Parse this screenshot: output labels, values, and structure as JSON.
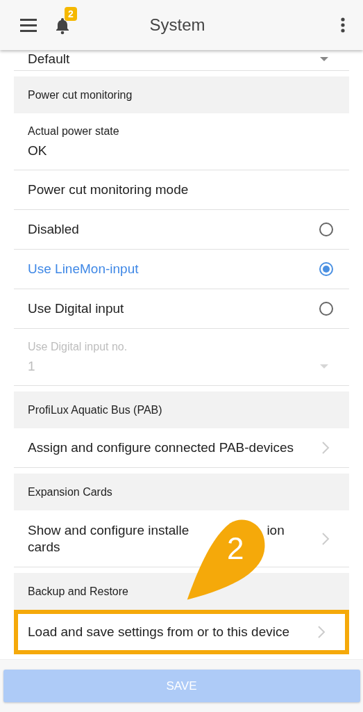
{
  "app_bar": {
    "title": "System",
    "notification_count": "2"
  },
  "items": [
    {
      "kind": "select",
      "value": "Default"
    },
    {
      "kind": "section",
      "label": "Power cut monitoring"
    },
    {
      "kind": "info",
      "label": "Actual power state",
      "value": "OK"
    },
    {
      "kind": "heading",
      "label": "Power cut monitoring mode"
    },
    {
      "kind": "radio",
      "label": "Disabled",
      "selected": false
    },
    {
      "kind": "radio",
      "label": "Use LineMon-input",
      "selected": true
    },
    {
      "kind": "radio",
      "label": "Use Digital input",
      "selected": false
    },
    {
      "kind": "select",
      "label": "Use Digital input no.",
      "value": "1",
      "disabled": true
    },
    {
      "kind": "section",
      "label": "ProfiLux Aquatic Bus (PAB)"
    },
    {
      "kind": "link",
      "label": "Assign and configure connected PAB-devices",
      "highlighted": false
    },
    {
      "kind": "section",
      "label": "Expansion Cards"
    },
    {
      "kind": "link",
      "label_parts": [
        "Show and configure installe",
        "ion"
      ],
      "label_line_2": "cards"
    },
    {
      "kind": "section",
      "label": "Backup and Restore"
    },
    {
      "kind": "link",
      "label": "Load and save settings from or to this device",
      "highlighted": true
    }
  ],
  "callout": {
    "number": "2"
  },
  "save_button": {
    "label": "SAVE",
    "disabled": true
  }
}
